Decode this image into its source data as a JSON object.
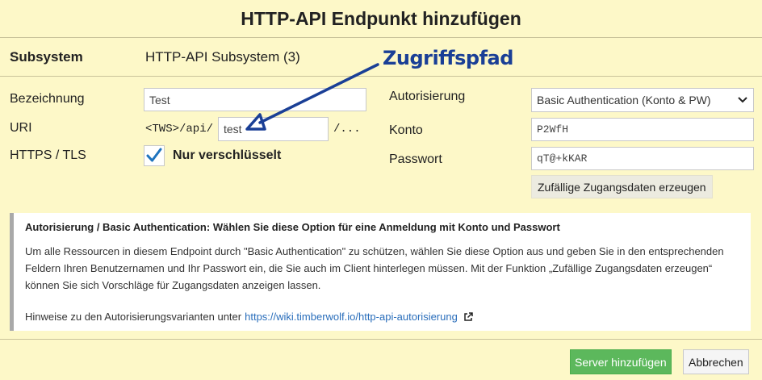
{
  "dialog": {
    "title": "HTTP-API Endpunkt hinzufügen"
  },
  "subsystem": {
    "label": "Subsystem",
    "value": "HTTP-API Subsystem (3)"
  },
  "form": {
    "name_label": "Bezeichnung",
    "name_value": "Test",
    "uri_label": "URI",
    "uri_prefix": "<TWS>/api/",
    "uri_value": "test",
    "uri_suffix": "/...",
    "https_label": "HTTPS / TLS",
    "https_checked": true,
    "https_checkbox_label": "Nur verschlüsselt",
    "auth_label": "Autorisierung",
    "auth_selected": "Basic Authentication (Konto & PW)",
    "account_label": "Konto",
    "account_value": "P2WfH",
    "password_label": "Passwort",
    "password_value": "qT@+kKAR",
    "generate_button": "Zufällige Zugangsdaten erzeugen"
  },
  "info": {
    "title": "Autorisierung / Basic Authentication: Wählen Sie diese Option für eine Anmeldung mit Konto und Passwort",
    "text": "Um alle Ressourcen in diesem Endpoint durch \"Basic Authentication\" zu schützen, wählen Sie diese Option aus und geben Sie in den entsprechenden Feldern Ihren Benutzernamen und Ihr Passwort ein, die Sie auch im Client hinterlegen müssen. Mit der Funktion „Zufällige Zugangsdaten erzeugen“ können Sie sich Vorschläge für Zugangsdaten anzeigen lassen.",
    "hint_prefix": "Hinweise zu den Autorisierungsvarianten unter",
    "hint_link": "https://wiki.timberwolf.io/http-api-autorisierung",
    "hint_icon": "external-link-icon"
  },
  "footer": {
    "add_button": "Server hinzufügen",
    "cancel_button": "Abbrechen"
  },
  "annotation": {
    "text": "Zugriffspfad",
    "color": "#1a3f96"
  },
  "colors": {
    "background": "#fdf8c8",
    "primary": "#5cb85c",
    "link": "#2a6ebb",
    "check": "#1e73be"
  }
}
